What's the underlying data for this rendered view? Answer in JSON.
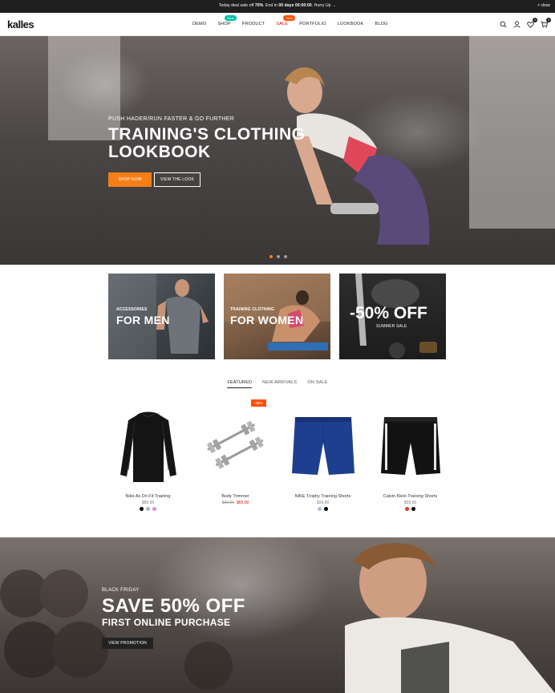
{
  "topbar": {
    "promo_prefix": "Today deal sale off",
    "promo_percent": "70%",
    "promo_mid": ". End in",
    "promo_timer": "00 days 00:00:00",
    "promo_suffix": ". Hurry Up →",
    "close": "× close"
  },
  "header": {
    "logo": "kalles",
    "nav": [
      {
        "label": "DEMO"
      },
      {
        "label": "SHOP",
        "badge": "New"
      },
      {
        "label": "PRODUCT"
      },
      {
        "label": "SALE",
        "badge": "Sale"
      },
      {
        "label": "PORTFOLIO"
      },
      {
        "label": "LOOKBOOK"
      },
      {
        "label": "BLOG"
      }
    ],
    "wishlist_count": "0",
    "cart_count": "0"
  },
  "hero": {
    "kicker": "PUSH HADER/RUN FASTER & GO FURTHER",
    "title_line1": "TRAINING'S CLOTHING",
    "title_line2": "LOOKBOOK",
    "primary_button": "SHOP NOW",
    "secondary_button": "VIEW THE LOOK",
    "slide_count": 3,
    "active_slide": 1,
    "colors": {
      "accent": "#f57f17"
    }
  },
  "categories": [
    {
      "small": "ACCESSORIES",
      "big": "FOR MEN"
    },
    {
      "small": "TRAINING CLOTHING",
      "big": "FOR WOMEN"
    },
    {
      "big": "-50% OFF",
      "small": "SUMMER SALE"
    }
  ],
  "tabs": [
    {
      "label": "FEATURED",
      "active": true
    },
    {
      "label": "NEW ARRIVALS",
      "active": false
    },
    {
      "label": "ON SALE",
      "active": false
    }
  ],
  "products": [
    {
      "name": "Nike As Dri Fit Training",
      "price": "$65.00",
      "swatches": [
        "#000000",
        "#aab6c4",
        "#d88ae0"
      ]
    },
    {
      "name": "Body Trimmer",
      "old_price": "$99.00",
      "price": "$65.00",
      "sale_badge": "-35%",
      "swatches": []
    },
    {
      "name": "NIKE Trophy Training Shorts",
      "price": "$19.00",
      "swatches": [
        "#aac0d8",
        "#000000"
      ]
    },
    {
      "name": "Calvin Klein Training Shorts",
      "price": "$29.00",
      "swatches": [
        "#e23b1b",
        "#000000"
      ]
    }
  ],
  "promo_banner": {
    "kicker": "BLACK FRIDAY",
    "title": "SAVE 50% OFF",
    "subtitle": "FIRST ONLINE PURCHASE",
    "button": "VIEW PROMOTION"
  }
}
